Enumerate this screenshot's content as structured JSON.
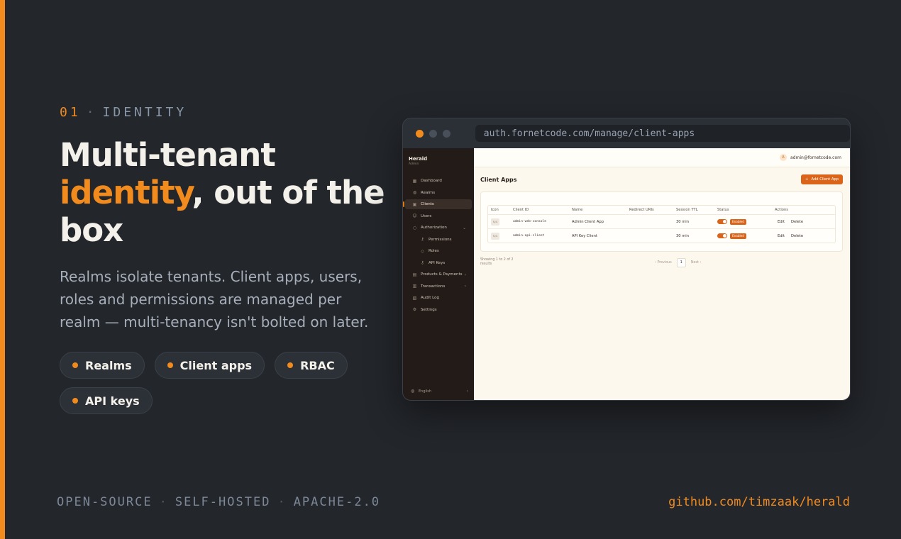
{
  "hero": {
    "eyebrow_number": "01",
    "eyebrow_sep": "·",
    "eyebrow_label": "IDENTITY",
    "headline_part1": "Multi-tenant ",
    "headline_highlight": "identity",
    "headline_part2": ", out of the box",
    "description": "Realms isolate tenants. Client apps, users, roles and permissions are managed per realm — multi-tenancy isn't bolted on later.",
    "pills": [
      "Realms",
      "Client apps",
      "RBAC",
      "API keys"
    ]
  },
  "footer": {
    "left_items": [
      "OPEN-SOURCE",
      "SELF-HOSTED",
      "APACHE-2.0"
    ],
    "separator": "·",
    "right_link": "github.com/timzaak/herald"
  },
  "colors": {
    "accent": "#f28b1e",
    "background": "#23262b",
    "traffic_lights": [
      "#f28b1e",
      "#4a5059",
      "#4a5059"
    ]
  },
  "browser": {
    "url": "auth.fornetcode.com/manage/client-apps"
  },
  "app": {
    "brand_name": "Herald",
    "brand_sub": "Admin",
    "nav": [
      {
        "label": "Dashboard",
        "icon": "grid-icon"
      },
      {
        "label": "Realms",
        "icon": "globe-icon"
      },
      {
        "label": "Clients",
        "icon": "box-icon",
        "active": true
      },
      {
        "label": "Users",
        "icon": "users-icon"
      },
      {
        "label": "Authorization",
        "icon": "shield-icon",
        "expanded": true
      },
      {
        "label": "Permissions",
        "icon": "key-icon",
        "sub": true
      },
      {
        "label": "Roles",
        "icon": "shield-icon",
        "sub": true
      },
      {
        "label": "API Keys",
        "icon": "key-icon",
        "sub": true
      },
      {
        "label": "Products & Payments",
        "icon": "cart-icon",
        "collapsed": true
      },
      {
        "label": "Transactions",
        "icon": "receipt-icon",
        "collapsed": true
      },
      {
        "label": "Audit Log",
        "icon": "log-icon"
      },
      {
        "label": "Settings",
        "icon": "gear-icon"
      }
    ],
    "language": "English",
    "user_initial": "A",
    "user_email": "admin@fornetcode.com",
    "page_title": "Client Apps",
    "add_button": "Add Client App",
    "columns": [
      "Icon",
      "Client ID",
      "Name",
      "Redirect URIs",
      "Session TTL",
      "Status",
      "Actions"
    ],
    "rows": [
      {
        "icon": "N/A",
        "client_id": "admin-web-console",
        "name": "Admin Client App",
        "redirect_uris": "",
        "ttl": "30 min",
        "status": "Enabled",
        "enabled": true,
        "edit": "Edit",
        "delete": "Delete"
      },
      {
        "icon": "N/A",
        "client_id": "admin-api-client",
        "name": "API Key Client",
        "redirect_uris": "",
        "ttl": "30 min",
        "status": "Enabled",
        "enabled": true,
        "edit": "Edit",
        "delete": "Delete"
      }
    ],
    "summary": "Showing 1 to 2 of 2 results",
    "pagination": {
      "previous": "Previous",
      "current_page": "1",
      "next": "Next"
    }
  }
}
